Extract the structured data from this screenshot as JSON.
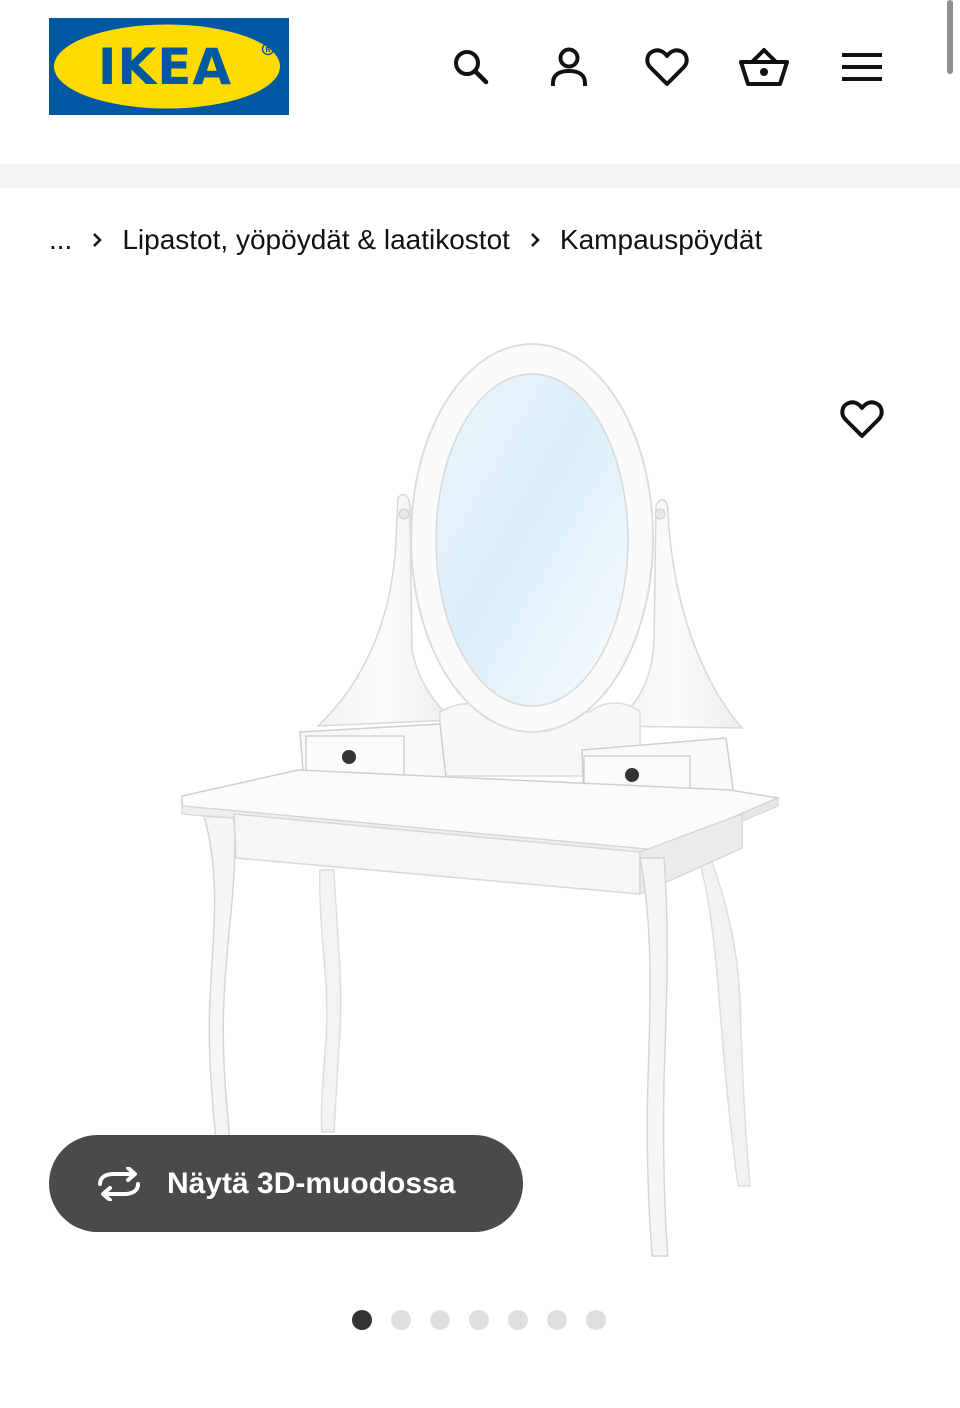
{
  "header": {
    "logo_text": "IKEA",
    "icons": {
      "search": "search-icon",
      "account": "user-icon",
      "favourites": "heart-icon",
      "basket": "basket-icon",
      "menu": "hamburger-menu-icon"
    }
  },
  "breadcrumb": {
    "ellipsis": "...",
    "items": [
      {
        "label": "Lipastot, yöpöydät & laatikostot"
      },
      {
        "label": "Kampauspöydät"
      }
    ]
  },
  "product": {
    "favourite_icon": "heart-icon",
    "view_3d_label": "Näytä 3D-muodossa",
    "view_3d_icon": "rotate-3d-icon",
    "gallery": {
      "total_images": 7,
      "active_index": 0
    }
  },
  "colors": {
    "brand_blue": "#0058A3",
    "brand_yellow": "#FFDB00",
    "button_dark": "#4a4a4a",
    "dot_active": "#333333",
    "dot_inactive": "#dfdfdf"
  }
}
